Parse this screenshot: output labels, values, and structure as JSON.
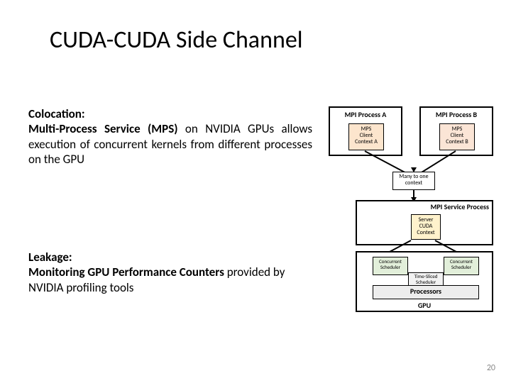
{
  "title": "CUDA-CUDA Side Channel",
  "colocation": {
    "heading": "Colocation:",
    "body_prefix": "Multi-Process Service (MPS) ",
    "body_rest": "on NVIDIA GPUs allows execution of concurrent kernels from different processes on the GPU"
  },
  "leakage": {
    "heading": "Leakage:",
    "body_prefix": "Monitoring GPU Performance Counters ",
    "body_rest": "provided by NVIDIA profiling tools"
  },
  "diagram": {
    "proc_a": "MPI Process A",
    "proc_b": "MPI Process B",
    "client_a": "MPS\nClient\nContext A",
    "client_b": "MPS\nClient\nContext B",
    "many": "Many to one\ncontext",
    "service_label": "MPI Service Process",
    "server_ctx": "Server\nCUDA\nContext",
    "sched_a": "Concurrent\nScheduler",
    "sched_b": "Concurrent\nScheduler",
    "sched_time": "Time-Sliced\nScheduler",
    "processors": "Processors",
    "gpu": "GPU"
  },
  "page_number": "20"
}
